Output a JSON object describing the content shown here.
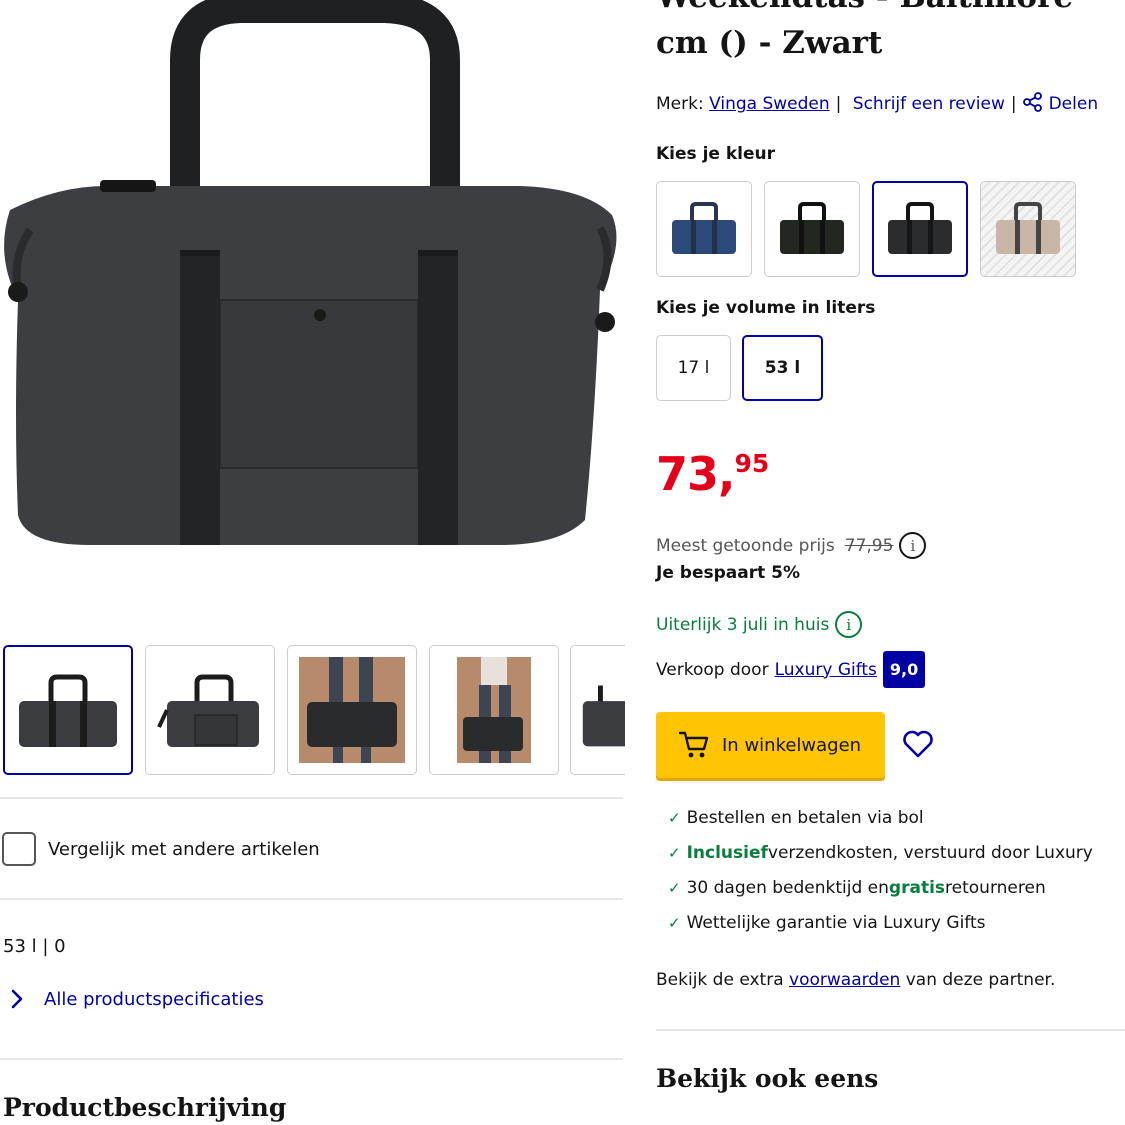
{
  "product": {
    "title_line1": "Weekendtas - Baltimore",
    "title_line2": "cm () - Zwart",
    "brand_label": "Merk:",
    "brand_name": "Vinga Sweden",
    "review_link": "Schrijf een review",
    "share_label": "Delen"
  },
  "color_picker": {
    "label": "Kies je kleur",
    "options": [
      {
        "name": "blue",
        "bag_color": "#2b4a7a"
      },
      {
        "name": "dark-green",
        "bag_color": "#22281f"
      },
      {
        "name": "black",
        "bag_color": "#2a2c2e",
        "selected": true
      },
      {
        "name": "beige",
        "bag_color": "#c9b6a6"
      }
    ]
  },
  "volume_picker": {
    "label": "Kies je volume in liters",
    "options": [
      {
        "label": "17 l",
        "selected": false
      },
      {
        "label": "53 l",
        "selected": true
      }
    ]
  },
  "price": {
    "euros": "73,",
    "cents": "95",
    "most_shown_label": "Meest getoonde prijs",
    "most_shown_value": "77,95",
    "saving": "Je bespaart 5%"
  },
  "delivery": {
    "text": "Uiterlijk 3 juli in huis"
  },
  "seller": {
    "label": "Verkoop door",
    "name": "Luxury Gifts",
    "rating": "9,0"
  },
  "actions": {
    "add_to_cart": "In winkelwagen"
  },
  "usps": [
    {
      "pre": "",
      "bold": "",
      "mid": "Bestellen en betalen via bol",
      "bold2": "",
      "post": ""
    },
    {
      "pre": "",
      "bold": "Inclusief",
      "mid": " verzendkosten, verstuurd door Luxury",
      "bold2": "",
      "post": ""
    },
    {
      "pre": "30 dagen bedenktijd en ",
      "bold": "",
      "mid": "",
      "bold2": "gratis",
      "post": " retourneren"
    },
    {
      "pre": "",
      "bold": "",
      "mid": "Wettelijke garantie via Luxury Gifts",
      "bold2": "",
      "post": ""
    }
  ],
  "terms": {
    "pre": "Bekijk de extra",
    "link": "voorwaarden",
    "post": "van deze partner."
  },
  "also_see": "Bekijk ook eens",
  "left": {
    "compare_label": "Vergelijk met andere artikelen",
    "spec_summary": "53 l | 0",
    "all_specs": "Alle productspecificaties",
    "description_heading": "Productbeschrijving"
  },
  "colors": {
    "link_blue": "#0000a4",
    "price_red": "#e3001b",
    "delivery_green": "#0a7d3e",
    "cart_yellow": "#ffc505"
  }
}
